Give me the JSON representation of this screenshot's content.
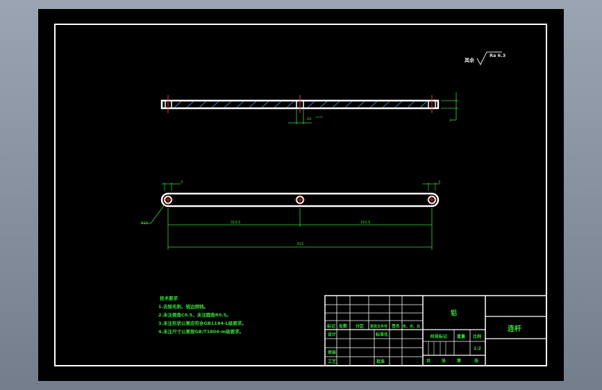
{
  "roughness_symbol": {
    "label": "其余",
    "value": "Ra 6.3"
  },
  "dimensions": {
    "top_thickness": "10",
    "top_tolerance": "+0.05",
    "right_radius_tag": "3",
    "left_radius_tag": "3",
    "hole_callout": "R10",
    "span_left": "310.5",
    "span_right": "310.5",
    "overall": "621",
    "side_small": "3"
  },
  "tech_notes": {
    "title": "技术要求",
    "items": [
      "1.去除毛刺、锐边倒钝。",
      "2.未注倒角C0.5，未注圆角R0.5。",
      "3.未注形状公差应符合GB1184-L级要求。",
      "4.未注尺寸公差按GB/T1804-m级要求。"
    ]
  },
  "title_block": {
    "material": "铝",
    "part_name": "连杆",
    "header_row": [
      "标记",
      "处数",
      "分区",
      "更改文件号",
      "签名",
      "年、月、日"
    ],
    "design": "设计",
    "standardize": "标准化",
    "review": "审核",
    "process": "工艺",
    "approve": "批准",
    "stage_mark": "阶段标记",
    "weight": "重量",
    "scale_label": "比例",
    "scale_value": "1:2",
    "sheets_row": [
      "共",
      "张",
      "第",
      "张"
    ]
  }
}
